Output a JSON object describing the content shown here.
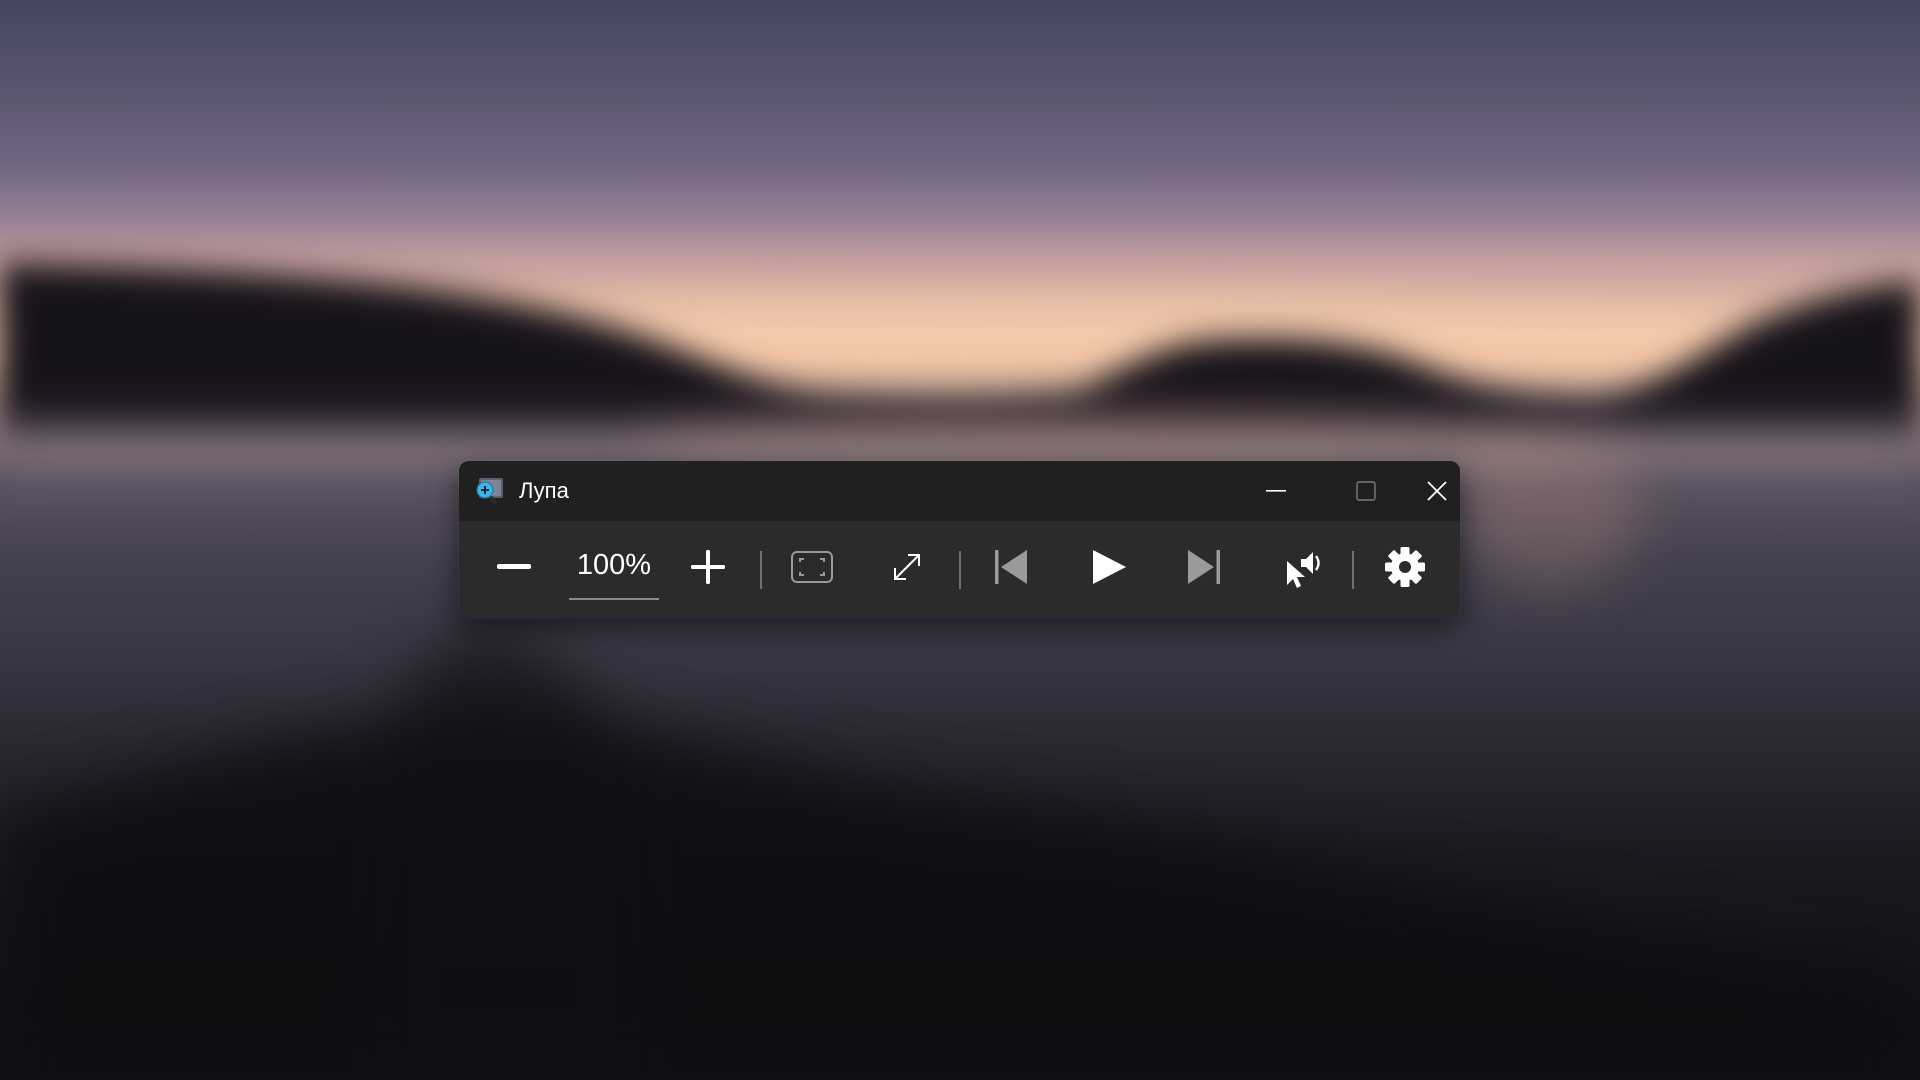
{
  "window": {
    "title": "Лупа",
    "app_icon": "magnifier-app-icon"
  },
  "caption_buttons": {
    "minimize": "minimize-icon",
    "maximize": "maximize-icon",
    "close": "close-icon"
  },
  "toolbar": {
    "zoom_out_icon": "minus-icon",
    "zoom_level": "100%",
    "zoom_in_icon": "plus-icon",
    "view_icon": "view-frame-icon",
    "fullscreen_icon": "expand-arrows-icon",
    "previous_icon": "skip-previous-icon",
    "play_icon": "play-icon",
    "next_icon": "skip-next-icon",
    "read_from_here_icon": "pointer-speaker-icon",
    "settings_icon": "gear-icon"
  },
  "colors": {
    "titlebar_bg": "#202020",
    "toolbar_bg": "#2b2b2b",
    "icon_white": "#ffffff",
    "icon_dim": "#9a9a9a",
    "app_icon_accent": "#37b8e6"
  }
}
